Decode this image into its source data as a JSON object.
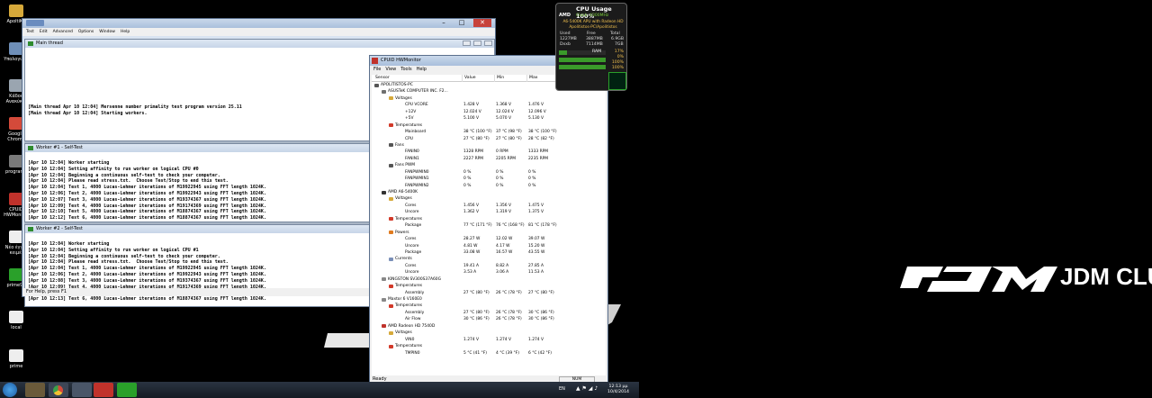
{
  "desktop": {
    "icons": [
      {
        "label": "ApoltiKA",
        "color": "#d6a93a"
      },
      {
        "label": "ΥπολογισΤ.",
        "color": "#6f8fb8"
      },
      {
        "label": "Κάδος Ανακύκλ.",
        "color": "#9aa5b0"
      },
      {
        "label": "Google Chrome",
        "color": "#d44a3a"
      },
      {
        "label": "programs",
        "color": "#7a7a7a"
      },
      {
        "label": "CPUID HWMonitor",
        "color": "#c0322b"
      },
      {
        "label": "Νέο έγγρ. κειμέ.",
        "color": "#eeeeee"
      },
      {
        "label": "prime95",
        "color": "#2aa02a"
      },
      {
        "label": "local",
        "color": "#eeeeee"
      },
      {
        "label": "prime",
        "color": "#eeeeee"
      }
    ],
    "wallpaper_text": "JDM CLUB VOL"
  },
  "prime95": {
    "title": "Prime95",
    "menu": [
      "Test",
      "Edit",
      "Advanced",
      "Options",
      "Window",
      "Help"
    ],
    "status": "For Help, press F1",
    "main_thread": {
      "title": "Main thread",
      "lines": [
        "[Main thread Apr 10 12:04] Mersenne number primality test program version 25.11",
        "[Main thread Apr 10 12:04] Starting workers."
      ]
    },
    "worker1": {
      "title": "Worker #1 - Self-Test",
      "lines": [
        "[Apr 10 12:04] Worker starting",
        "[Apr 10 12:04] Setting affinity to run worker on logical CPU #0",
        "[Apr 10 12:04] Beginning a continuous self-test to check your computer.",
        "[Apr 10 12:04] Please read stress.txt.  Choose Test/Stop to end this test.",
        "[Apr 10 12:04] Test 1, 4000 Lucas-Lehmer iterations of M19922945 using FFT length 1024K.",
        "[Apr 10 12:06] Test 2, 4000 Lucas-Lehmer iterations of M19922943 using FFT length 1024K.",
        "[Apr 10 12:07] Test 3, 4000 Lucas-Lehmer iterations of M19374367 using FFT length 1024K.",
        "[Apr 10 12:09] Test 4, 4000 Lucas-Lehmer iterations of M19174369 using FFT length 1024K.",
        "[Apr 10 12:10] Test 5, 4000 Lucas-Lehmer iterations of M18874367 using FFT length 1024K.",
        "[Apr 10 12:12] Test 6, 4000 Lucas-Lehmer iterations of M18874367 using FFT length 1024K."
      ]
    },
    "worker2": {
      "title": "Worker #2 - Self-Test",
      "lines": [
        "[Apr 10 12:04] Worker starting",
        "[Apr 10 12:04] Setting affinity to run worker on logical CPU #1",
        "[Apr 10 12:04] Beginning a continuous self-test to check your computer.",
        "[Apr 10 12:04] Please read stress.txt.  Choose Test/Stop to end this test.",
        "[Apr 10 12:04] Test 1, 4000 Lucas-Lehmer iterations of M19922945 using FFT length 1024K.",
        "[Apr 10 12:06] Test 2, 4000 Lucas-Lehmer iterations of M19922943 using FFT length 1024K.",
        "[Apr 10 12:08] Test 3, 4000 Lucas-Lehmer iterations of M19374367 using FFT length 1024K.",
        "[Apr 10 12:09] Test 4, 4000 Lucas-Lehmer iterations of M19174369 using FFT length 1024K.",
        "[Apr 10 12:11] Test 5, 4000 Lucas-Lehmer iterations of M18874369 using FFT length 1024K.",
        "[Apr 10 12:13] Test 6, 4000 Lucas-Lehmer iterations of M18874367 using FFT length 1024K."
      ]
    }
  },
  "hwmonitor": {
    "title": "CPUID HWMonitor",
    "menu": [
      "File",
      "View",
      "Tools",
      "Help"
    ],
    "columns": [
      "Sensor",
      "Value",
      "Min",
      "Max"
    ],
    "status": "Ready",
    "num_indicator": "NUM",
    "rows": [
      {
        "level": 0,
        "kind": "pc",
        "label": "APOLITISTOS-PC",
        "v": "",
        "mn": "",
        "mx": ""
      },
      {
        "level": 1,
        "kind": "board",
        "label": "ASUSTeK COMPUTER INC. F2...",
        "v": "",
        "mn": "",
        "mx": ""
      },
      {
        "level": 2,
        "kind": "volt",
        "label": "Voltages",
        "v": "",
        "mn": "",
        "mx": ""
      },
      {
        "level": 3,
        "kind": "",
        "label": "CPU VCORE",
        "v": "1.428 V",
        "mn": "1.368 V",
        "mx": "1.476 V"
      },
      {
        "level": 3,
        "kind": "",
        "label": "+12V",
        "v": "12.024 V",
        "mn": "12.024 V",
        "mx": "12.096 V"
      },
      {
        "level": 3,
        "kind": "",
        "label": "+5V",
        "v": "5.100 V",
        "mn": "5.070 V",
        "mx": "5.130 V"
      },
      {
        "level": 2,
        "kind": "temp",
        "label": "Temperatures",
        "v": "",
        "mn": "",
        "mx": ""
      },
      {
        "level": 3,
        "kind": "",
        "label": "Mainboard",
        "v": "38 °C  (100 °F)",
        "mn": "37 °C  (98 °F)",
        "mx": "38 °C  (100 °F)"
      },
      {
        "level": 3,
        "kind": "",
        "label": "CPU",
        "v": "27 °C  (80 °F)",
        "mn": "27 °C  (80 °F)",
        "mx": "28 °C  (82 °F)"
      },
      {
        "level": 2,
        "kind": "fan",
        "label": "Fans",
        "v": "",
        "mn": "",
        "mx": ""
      },
      {
        "level": 3,
        "kind": "",
        "label": "FANIN0",
        "v": "1328 RPM",
        "mn": "0 RPM",
        "mx": "1333 RPM"
      },
      {
        "level": 3,
        "kind": "",
        "label": "FANIN1",
        "v": "2227 RPM",
        "mn": "2205 RPM",
        "mx": "2235 RPM"
      },
      {
        "level": 2,
        "kind": "fan",
        "label": "Fans PWM",
        "v": "",
        "mn": "",
        "mx": ""
      },
      {
        "level": 3,
        "kind": "",
        "label": "FANPWMIN0",
        "v": "0 %",
        "mn": "0 %",
        "mx": "0 %"
      },
      {
        "level": 3,
        "kind": "",
        "label": "FANPWMIN1",
        "v": "0 %",
        "mn": "0 %",
        "mx": "0 %"
      },
      {
        "level": 3,
        "kind": "",
        "label": "FANPWMIN2",
        "v": "0 %",
        "mn": "0 %",
        "mx": "0 %"
      },
      {
        "level": 1,
        "kind": "chip",
        "label": "AMD A6-5400K",
        "v": "",
        "mn": "",
        "mx": ""
      },
      {
        "level": 2,
        "kind": "volt",
        "label": "Voltages",
        "v": "",
        "mn": "",
        "mx": ""
      },
      {
        "level": 3,
        "kind": "",
        "label": "Cores",
        "v": "1.456 V",
        "mn": "1.356 V",
        "mx": "1.475 V"
      },
      {
        "level": 3,
        "kind": "",
        "label": "Uncore",
        "v": "1.362 V",
        "mn": "1.319 V",
        "mx": "1.375 V"
      },
      {
        "level": 2,
        "kind": "temp",
        "label": "Temperatures",
        "v": "",
        "mn": "",
        "mx": ""
      },
      {
        "level": 3,
        "kind": "",
        "label": "Package",
        "v": "77 °C  (171 °F)",
        "mn": "76 °C  (168 °F)",
        "mx": "81 °C  (178 °F)"
      },
      {
        "level": 2,
        "kind": "power",
        "label": "Powers",
        "v": "",
        "mn": "",
        "mx": ""
      },
      {
        "level": 3,
        "kind": "",
        "label": "Cores",
        "v": "28.27 W",
        "mn": "12.02 W",
        "mx": "39.07 W"
      },
      {
        "level": 3,
        "kind": "",
        "label": "Uncore",
        "v": "4.81 W",
        "mn": "4.17 W",
        "mx": "15.20 W"
      },
      {
        "level": 3,
        "kind": "",
        "label": "Package",
        "v": "33.08 W",
        "mn": "16.57 W",
        "mx": "43.55 W"
      },
      {
        "level": 2,
        "kind": "curr",
        "label": "Currents",
        "v": "",
        "mn": "",
        "mx": ""
      },
      {
        "level": 3,
        "kind": "",
        "label": "Cores",
        "v": "19.41 A",
        "mn": "8.82 A",
        "mx": "27.85 A"
      },
      {
        "level": 3,
        "kind": "",
        "label": "Uncore",
        "v": "3.53 A",
        "mn": "3.06 A",
        "mx": "11.53 A"
      },
      {
        "level": 1,
        "kind": "disk",
        "label": "KINGSTON  SV300S37A60G",
        "v": "",
        "mn": "",
        "mx": ""
      },
      {
        "level": 2,
        "kind": "temp",
        "label": "Temperatures",
        "v": "",
        "mn": "",
        "mx": ""
      },
      {
        "level": 3,
        "kind": "",
        "label": "Assembly",
        "v": "27 °C  (80 °F)",
        "mn": "26 °C  (78 °F)",
        "mx": "27 °C  (80 °F)"
      },
      {
        "level": 1,
        "kind": "disk",
        "label": "Maxtor 6 V160E0",
        "v": "",
        "mn": "",
        "mx": ""
      },
      {
        "level": 2,
        "kind": "temp",
        "label": "Temperatures",
        "v": "",
        "mn": "",
        "mx": ""
      },
      {
        "level": 3,
        "kind": "",
        "label": "Assembly",
        "v": "27 °C  (80 °F)",
        "mn": "26 °C  (78 °F)",
        "mx": "30 °C  (86 °F)"
      },
      {
        "level": 3,
        "kind": "",
        "label": "Air Flow",
        "v": "30 °C  (86 °F)",
        "mn": "26 °C  (78 °F)",
        "mx": "30 °C  (86 °F)"
      },
      {
        "level": 1,
        "kind": "gpu",
        "label": "AMD Radeon HD 7540D",
        "v": "",
        "mn": "",
        "mx": ""
      },
      {
        "level": 2,
        "kind": "volt",
        "label": "Voltages",
        "v": "",
        "mn": "",
        "mx": ""
      },
      {
        "level": 3,
        "kind": "",
        "label": "VIN0",
        "v": "1.274 V",
        "mn": "1.274 V",
        "mx": "1.274 V"
      },
      {
        "level": 2,
        "kind": "temp",
        "label": "Temperatures",
        "v": "",
        "mn": "",
        "mx": ""
      },
      {
        "level": 3,
        "kind": "",
        "label": "TMPIN0",
        "v": "5 °C  (41 °F)",
        "mn": "4 °C  (39 °F)",
        "mx": "6 °C  (42 °F)"
      }
    ]
  },
  "gadget": {
    "title": "CPU Usage 100%",
    "brand": "AMD",
    "clock": "Clock: 4300MHz",
    "cpu": "A6-5400K APU with Radeon HD",
    "host": "Apolitistos-PC\\Apolitistos",
    "hdr": [
      "Used",
      "Free",
      "Total"
    ],
    "ram_vals": [
      "1227MB",
      "3887MB",
      "6.9GB"
    ],
    "swap_label": "Dxxb",
    "swap_vals": [
      "",
      "7114MB",
      "7GB"
    ],
    "ram_label": "RAM",
    "ram_pct": "17%",
    "rows_pct": [
      "0%",
      "100%",
      "100%"
    ],
    "ram_fill": 0.17,
    "core_fill": [
      1.0,
      1.0
    ]
  },
  "taskbar": {
    "lang": "EN",
    "time": "12:13 μμ",
    "date": "10/4/2014"
  }
}
